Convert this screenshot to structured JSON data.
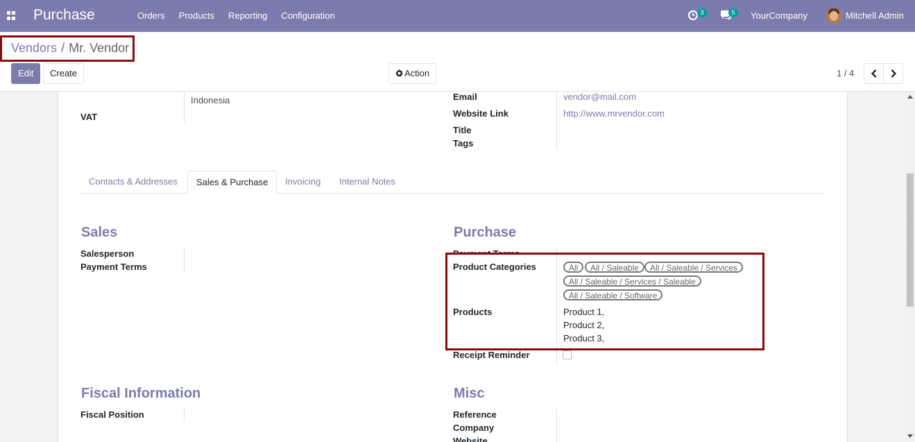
{
  "navbar": {
    "app_title": "Purchase",
    "menu": [
      "Orders",
      "Products",
      "Reporting",
      "Configuration"
    ],
    "activity_count": "3",
    "message_count": "5",
    "company": "YourCompany",
    "user": "Mitchell Admin",
    "color": "#7c7bad"
  },
  "breadcrumb": {
    "parent": "Vendors",
    "separator": "/",
    "current": "Mr. Vendor"
  },
  "buttons": {
    "edit": "Edit",
    "create": "Create",
    "action": "Action"
  },
  "pager": {
    "text": "1 / 4"
  },
  "top_fields": {
    "country_value": "Indonesia",
    "vat_label": "VAT",
    "email_label": "Email",
    "email_value": "vendor@mail.com",
    "website_label": "Website Link",
    "website_value": "http://www.mrvendor.com",
    "title_label": "Title",
    "tags_label": "Tags"
  },
  "tabs": [
    "Contacts & Addresses",
    "Sales & Purchase",
    "Invoicing",
    "Internal Notes"
  ],
  "active_tab": "Sales & Purchase",
  "sales": {
    "title": "Sales",
    "salesperson_label": "Salesperson",
    "payment_terms_label": "Payment Terms"
  },
  "purchase": {
    "title": "Purchase",
    "payment_terms_label": "Payment Terms",
    "product_categories_label": "Product Categories",
    "product_categories": [
      "All",
      "All / Saleable",
      "All / Saleable / Services",
      "All / Saleable / Services / Saleable",
      "All / Saleable / Software"
    ],
    "products_label": "Products",
    "products": [
      "Product 1,",
      "Product 2,",
      "Product 3,"
    ],
    "receipt_reminder_label": "Receipt Reminder"
  },
  "fiscal": {
    "title": "Fiscal Information",
    "fiscal_position_label": "Fiscal Position"
  },
  "misc": {
    "title": "Misc",
    "reference_label": "Reference",
    "company_label": "Company",
    "website_label": "Website"
  }
}
